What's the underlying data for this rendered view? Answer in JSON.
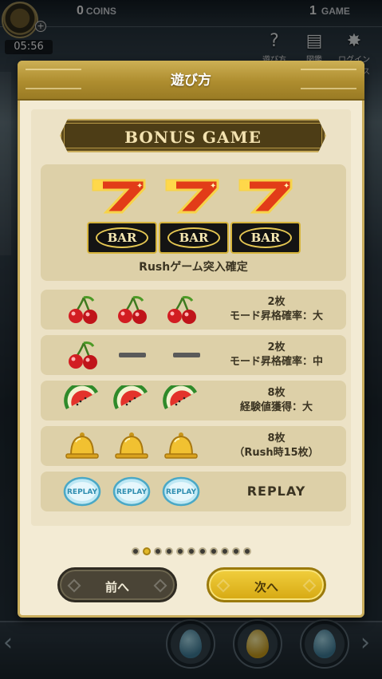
{
  "hud": {
    "time": "05:56",
    "coins_value": "0",
    "coins_label": "COINS",
    "games_value": "1",
    "games_label": "GAME",
    "buttons": [
      {
        "icon": "help-icon",
        "label": "遊び方"
      },
      {
        "icon": "book-icon",
        "label": "図鑑"
      },
      {
        "icon": "login-bonus-icon",
        "label": "ログインボーナス"
      }
    ]
  },
  "modal": {
    "title": "遊び方",
    "banner": "BONUS GAME",
    "jackpot": {
      "symbols": [
        "seven",
        "seven",
        "seven"
      ],
      "bar_symbols": [
        "BAR",
        "BAR",
        "BAR"
      ],
      "description": "Rushゲーム突入確定"
    },
    "paytable": [
      {
        "symbols": [
          "cherry",
          "cherry",
          "cherry"
        ],
        "line1": "2枚",
        "line2": "モード昇格確率：大"
      },
      {
        "symbols": [
          "cherry",
          "dash",
          "dash"
        ],
        "line1": "2枚",
        "line2": "モード昇格確率：中"
      },
      {
        "symbols": [
          "watermelon",
          "watermelon",
          "watermelon"
        ],
        "line1": "8枚",
        "line2": "経験値獲得：大"
      },
      {
        "symbols": [
          "bell",
          "bell",
          "bell"
        ],
        "line1": "8枚",
        "line2": "（Rush時15枚）"
      },
      {
        "symbols": [
          "replay",
          "replay",
          "replay"
        ],
        "line1": "REPLAY",
        "replay_label": "REPLAY"
      }
    ],
    "pager": {
      "total": 11,
      "current": 2
    },
    "prev_label": "前へ",
    "next_label": "次へ"
  },
  "colors": {
    "header_gold": "#ae8d2f",
    "panel_bg": "#f3ebd4",
    "row_bg": "#ddd0a8",
    "next_button": "#e0b521",
    "prev_button": "#4a4436"
  }
}
